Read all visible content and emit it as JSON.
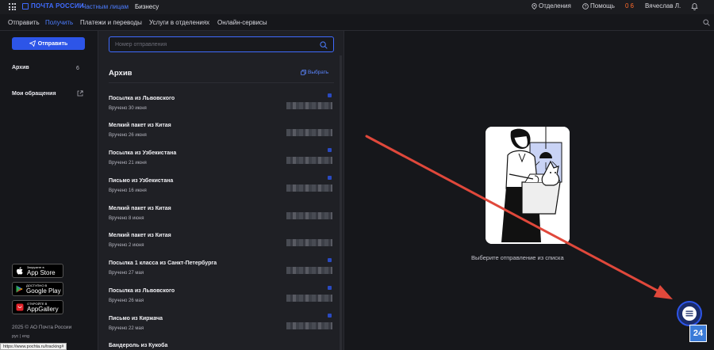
{
  "header": {
    "logo_text": "ПОЧТА РОССИИ",
    "segment_private": "Частным лицам",
    "segment_business": "Бизнесу",
    "offices": "Отделения",
    "help": "Помощь",
    "points_zero": "0",
    "points_value": "6",
    "user_name": "Вячеслав Л."
  },
  "nav": [
    "Отправить",
    "Получить",
    "Платежи и переводы",
    "Услуги в отделениях",
    "Онлайн-сервисы"
  ],
  "sidebar": {
    "send_button": "Отправить",
    "archive_label": "Архив",
    "archive_count": "6",
    "appeals_label": "Мои обращения",
    "stores": [
      {
        "sub": "Загрузите в",
        "name": "App Store"
      },
      {
        "sub": "ДОСТУПНО В",
        "name": "Google Play"
      },
      {
        "sub": "ОТКРОЙТЕ В",
        "name": "AppGallery"
      }
    ],
    "copyright": "2025 © АО Почта России",
    "lang": "рус | eng",
    "status_url": "https://www.pochta.ru/tracking#"
  },
  "list": {
    "search_placeholder": "Номер отправления",
    "title": "Архив",
    "select_label": "Выбрать",
    "items": [
      {
        "title": "Посылка из Львовского",
        "status": "Вручено 30 июня"
      },
      {
        "title": "Мелкий пакет из Китая",
        "status": "Вручено 26 июня"
      },
      {
        "title": "Посылка из Узбекистана",
        "status": "Вручено 21 июня"
      },
      {
        "title": "Письмо из Узбекистана",
        "status": "Вручено 16 июня"
      },
      {
        "title": "Мелкий пакет из Китая",
        "status": "Вручено 8 июня"
      },
      {
        "title": "Мелкий пакет из Китая",
        "status": "Вручено 2 июня"
      },
      {
        "title": "Посылка 1 класса из Санкт-Петербурга",
        "status": "Вручено 27 мая"
      },
      {
        "title": "Посылка из Львовского",
        "status": "Вручено 26 мая"
      },
      {
        "title": "Письмо из Киржача",
        "status": "Вручено 22 мая"
      },
      {
        "title": "Бандероль из Кукоба",
        "status": ""
      }
    ]
  },
  "detail": {
    "empty_message": "Выберите отправление из списка",
    "badge": "24"
  },
  "colors": {
    "accent": "#3f6bff",
    "points": "#ff6a2b",
    "annotation_arrow": "#e0483b"
  }
}
